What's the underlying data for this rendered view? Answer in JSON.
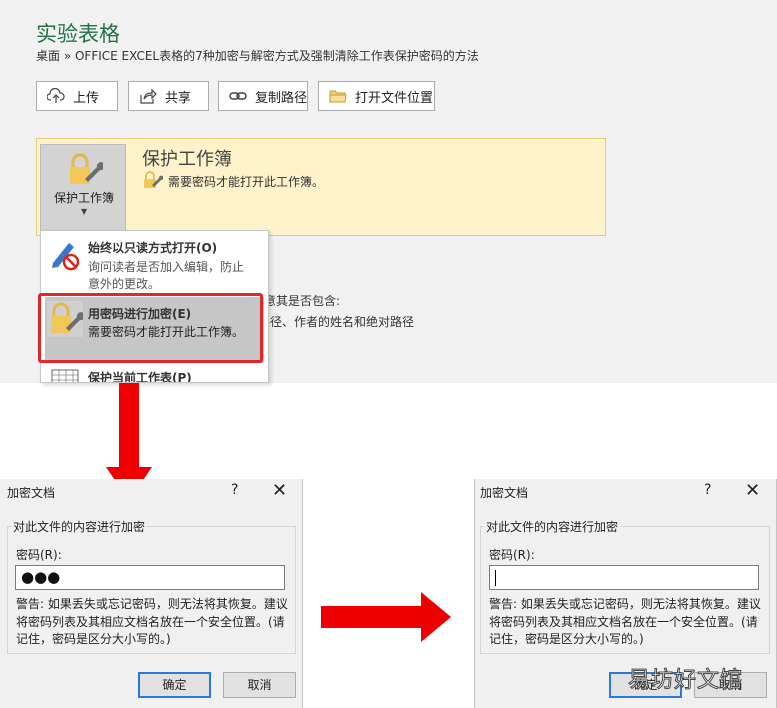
{
  "backstage": {
    "title": "实验表格",
    "breadcrumb": "桌面 » OFFICE EXCEL表格的7种加密与解密方式及强制清除工作表保护密码的方法",
    "buttons": [
      {
        "label": "上传",
        "icon": "upload-icon"
      },
      {
        "label": "共享",
        "icon": "share-icon"
      },
      {
        "label": "复制路径",
        "icon": "link-icon"
      },
      {
        "label": "打开文件位置",
        "icon": "folder-icon"
      }
    ],
    "protect": {
      "tile_label": "保护工作簿",
      "heading": "保护工作簿",
      "description": "需要密码才能打开此工作簿。"
    },
    "background_text": {
      "line1": "注意其是否包含:",
      "line2": "路径、作者的姓名和绝对路径"
    }
  },
  "menu": {
    "items": [
      {
        "title": "始终以只读方式打开(O)",
        "description": "询问读者是否加入编辑，防止意外的更改。",
        "icon": "read-only-pen-icon"
      },
      {
        "title": "用密码进行加密(E)",
        "description": "需要密码才能打开此工作簿。",
        "icon": "lock-key-icon"
      },
      {
        "title": "保护当前工作表(P)",
        "description": "",
        "icon": "sheet-grid-icon"
      }
    ]
  },
  "dialog_left": {
    "title": "加密文档",
    "help": "?",
    "close": "✕",
    "group_label": "对此文件的内容进行加密",
    "password_label": "密码(R):",
    "password_value": "●●●",
    "warning": "警告: 如果丢失或忘记密码，则无法将其恢复。建议将密码列表及其相应文档名放在一个安全位置。(请记住，密码是区分大小写的。)",
    "ok_label": "确定",
    "cancel_label": "取消"
  },
  "dialog_right": {
    "title": "加密文档",
    "help": "?",
    "close": "✕",
    "group_label": "对此文件的内容进行加密",
    "password_label": "密码(R):",
    "password_value": "",
    "warning": "警告: 如果丢失或忘记密码，则无法将其恢复。建议将密码列表及其相应文档名放在一个安全位置。(请记住，密码是区分大小写的。)",
    "ok_label": "确定",
    "cancel_label": "取消"
  },
  "watermark": "易坊好文馆",
  "colors": {
    "accent_green": "#217346",
    "highlight_red": "#e0282b",
    "arrow_red": "#ee0000",
    "protect_bg": "#fdf2c9"
  }
}
